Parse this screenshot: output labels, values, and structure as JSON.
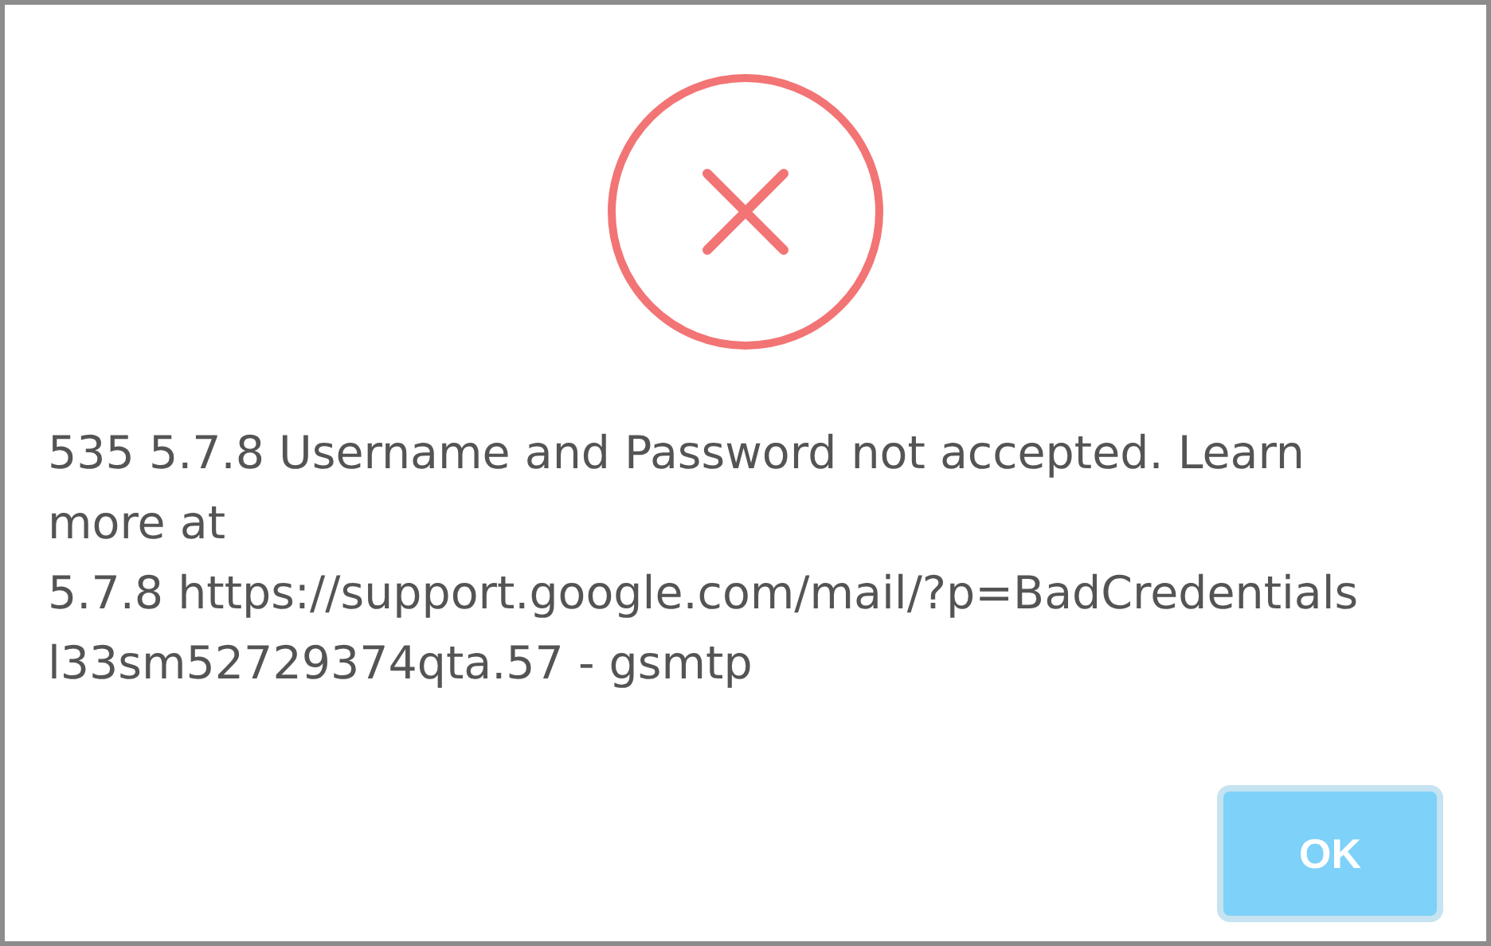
{
  "dialog": {
    "message_lines": [
      "535 5.7.8 Username and Password not accepted. Learn",
      "more at",
      "5.7.8 https://support.google.com/mail/?p=BadCredentials",
      "l33sm52729374qta.57 - gsmtp"
    ],
    "buttons": [
      "OK"
    ]
  }
}
